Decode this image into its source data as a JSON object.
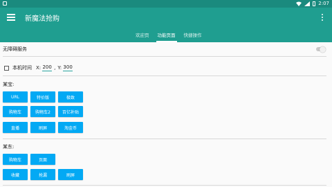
{
  "statusbar": {
    "time": "2:07"
  },
  "app": {
    "title": "新魔法抢购"
  },
  "tabs": [
    {
      "label": "欢迎页",
      "active": false
    },
    {
      "label": "功能页面",
      "active": true
    },
    {
      "label": "快捷操作",
      "active": false
    }
  ],
  "a11y": {
    "label": "无障碍服务",
    "enabled": false
  },
  "time": {
    "checkbox_label": "本机时间",
    "x_label": "X:",
    "x_value": "200",
    "sep": ",",
    "y_label": "Y:",
    "y_value": "300"
  },
  "section1": {
    "title": "某宝:",
    "buttons": [
      "URL",
      "特价版",
      "极致",
      "购物车",
      "购物车2",
      "百亿补贴",
      "直播",
      "刷屏",
      "淘金币"
    ]
  },
  "section2": {
    "title": "某东:",
    "buttons": [
      "购物车",
      "页面",
      "收藏",
      "抢漏",
      "刷屏"
    ]
  },
  "colors": {
    "appbar": "#1f9e90",
    "statusbar": "#1a8a7e",
    "button": "#03a9f4"
  }
}
